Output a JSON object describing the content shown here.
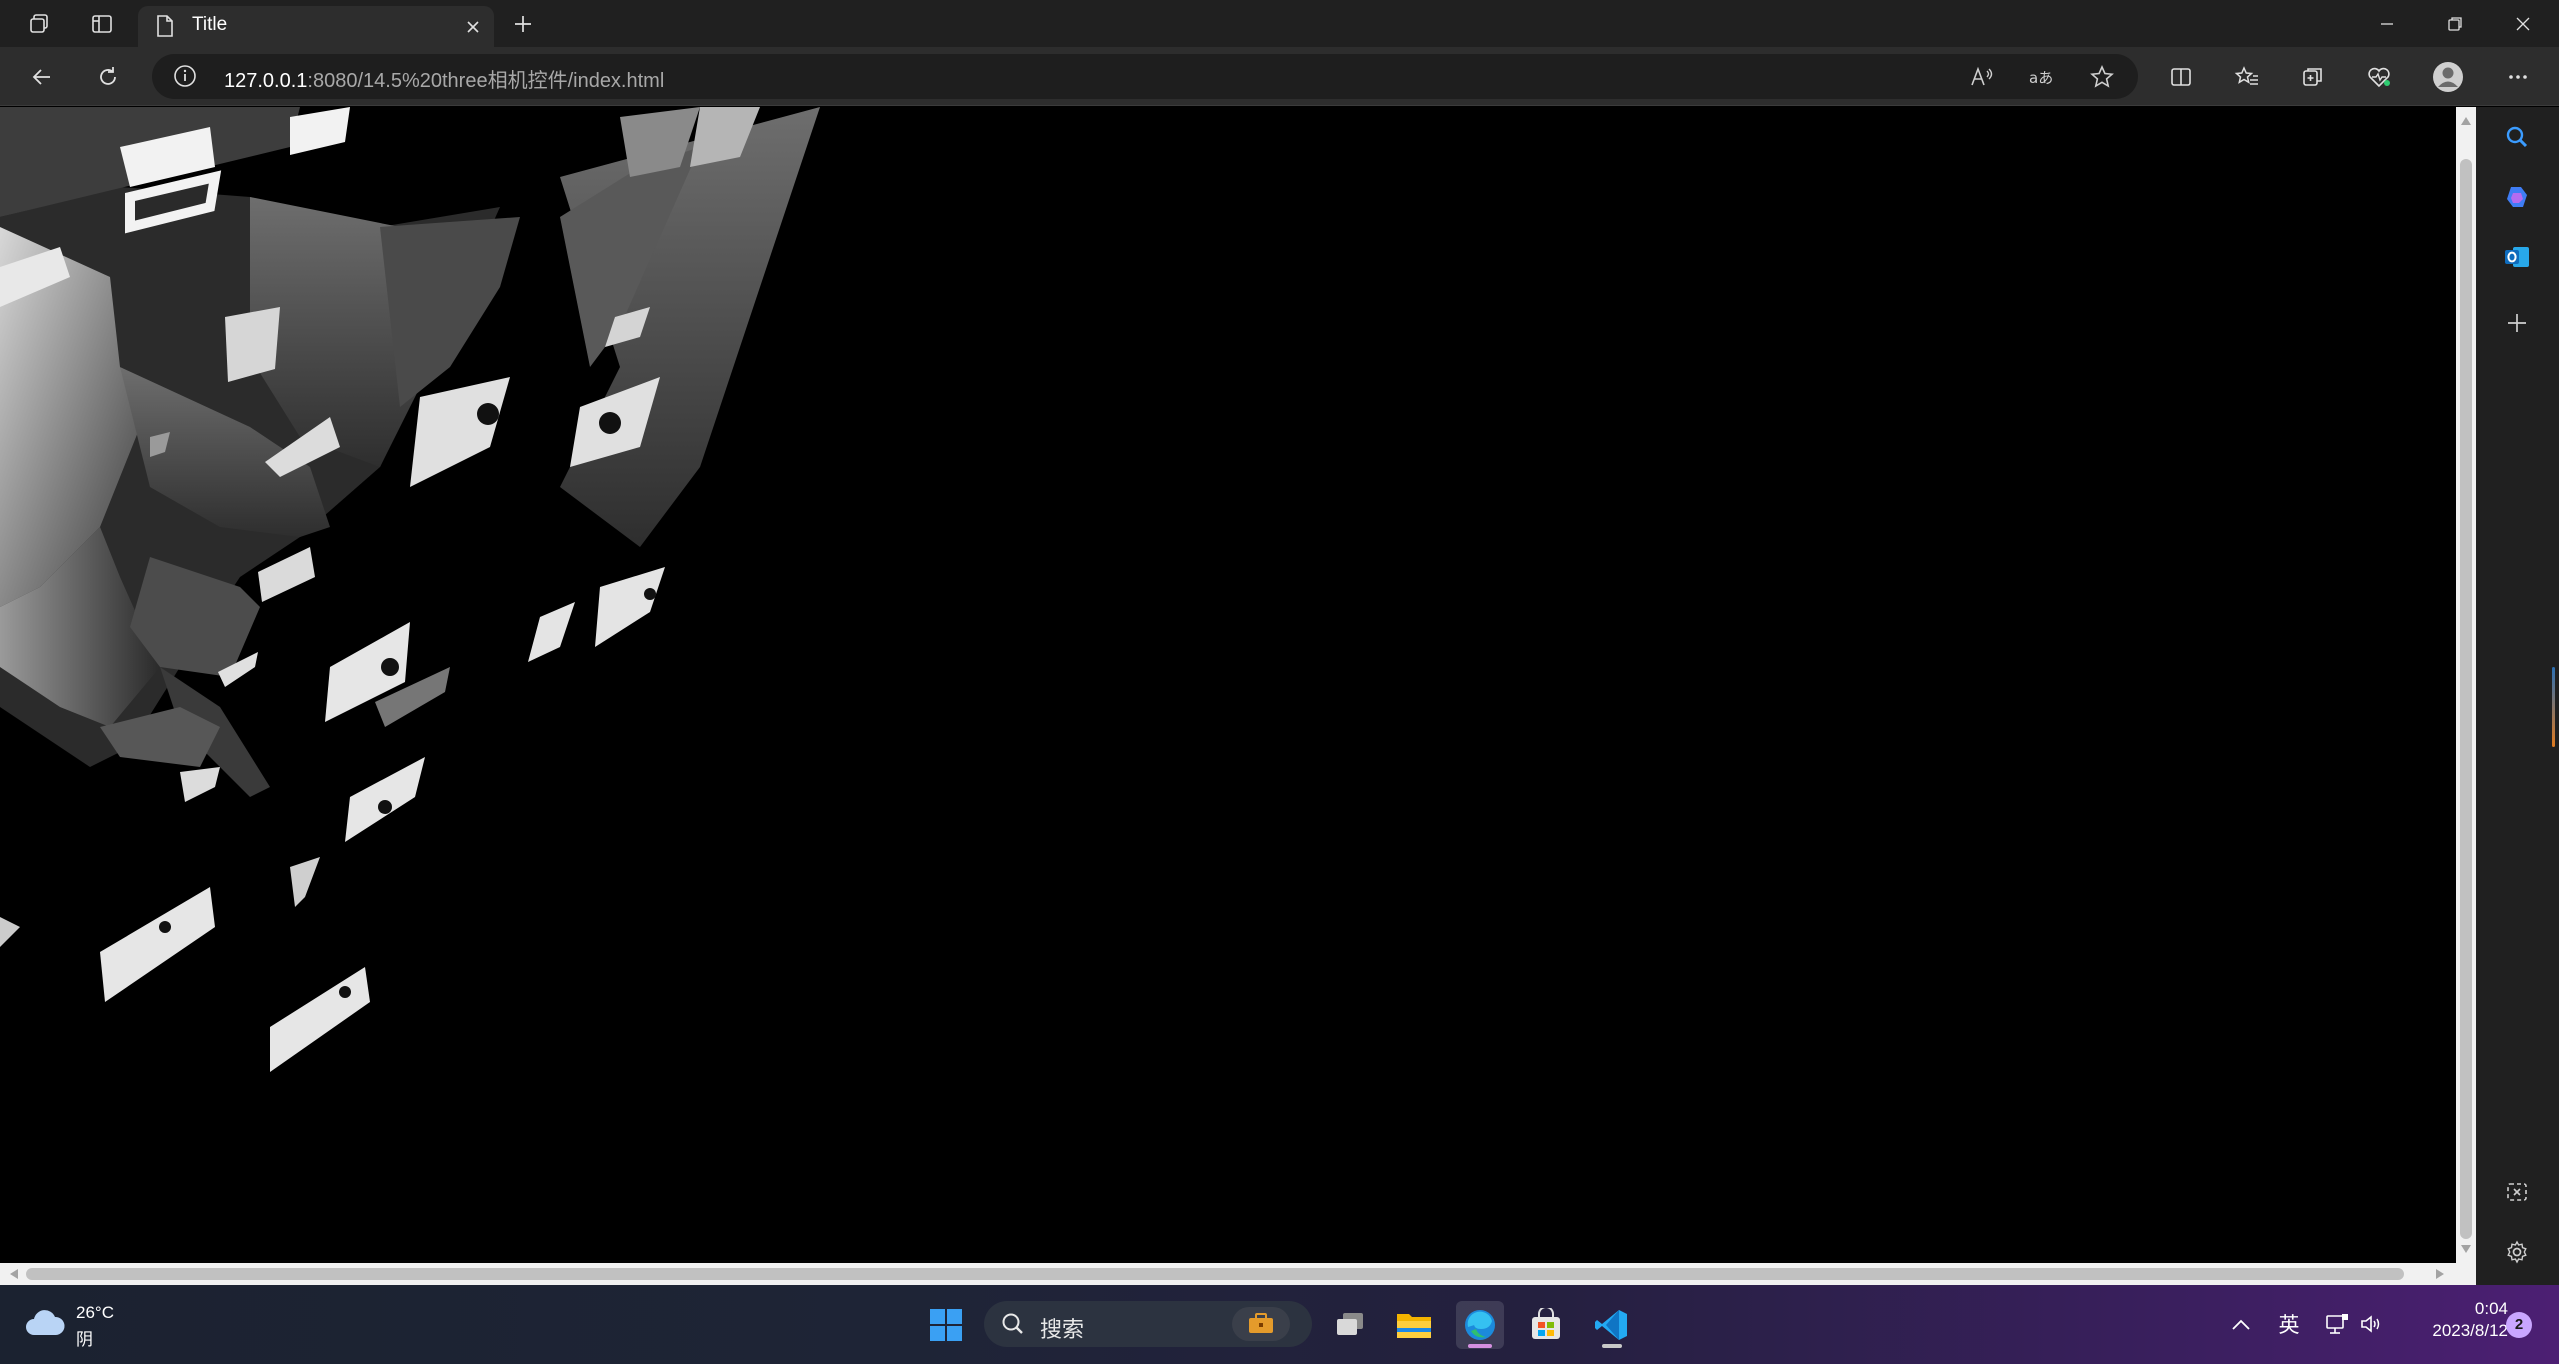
{
  "browser": {
    "tab_title": "Title",
    "address_host": "127.0.0.1",
    "address_path": ":8080/14.5%20three相机控件/index.html"
  },
  "taskbar": {
    "weather_temp": "26°C",
    "weather_condition": "阴",
    "search_label": "搜索",
    "ime_label": "英",
    "clock_time": "0:04",
    "clock_date": "2023/8/12",
    "notification_count": "2"
  },
  "colors": {
    "tabbar_bg": "#202020",
    "toolbar_bg": "#2d2d2d",
    "viewport_bg": "#000000",
    "taskbar_accent": "#4c1f73"
  },
  "icons": {
    "tabbar": [
      "workspaces-icon",
      "vertical-tabs-icon",
      "page-icon",
      "close-icon",
      "new-tab-icon"
    ],
    "window": [
      "minimize-icon",
      "restore-icon",
      "close-window-icon"
    ],
    "toolbar": [
      "back-icon",
      "refresh-icon",
      "info-icon",
      "read-aloud-icon",
      "translate-icon",
      "favorite-star-icon",
      "split-screen-icon",
      "favorites-icon",
      "collections-icon",
      "browser-essentials-icon",
      "profile-icon",
      "more-icon"
    ],
    "sidebar": [
      "search-icon",
      "copilot-icon",
      "outlook-icon",
      "add-icon",
      "screenshot-icon",
      "settings-icon"
    ],
    "taskbar": [
      "weather-cloud-icon",
      "start-icon",
      "search-icon",
      "widgets-icon",
      "task-view-icon",
      "file-explorer-icon",
      "edge-icon",
      "store-icon",
      "vscode-icon",
      "chevron-up-icon",
      "display-icon",
      "volume-icon"
    ]
  }
}
